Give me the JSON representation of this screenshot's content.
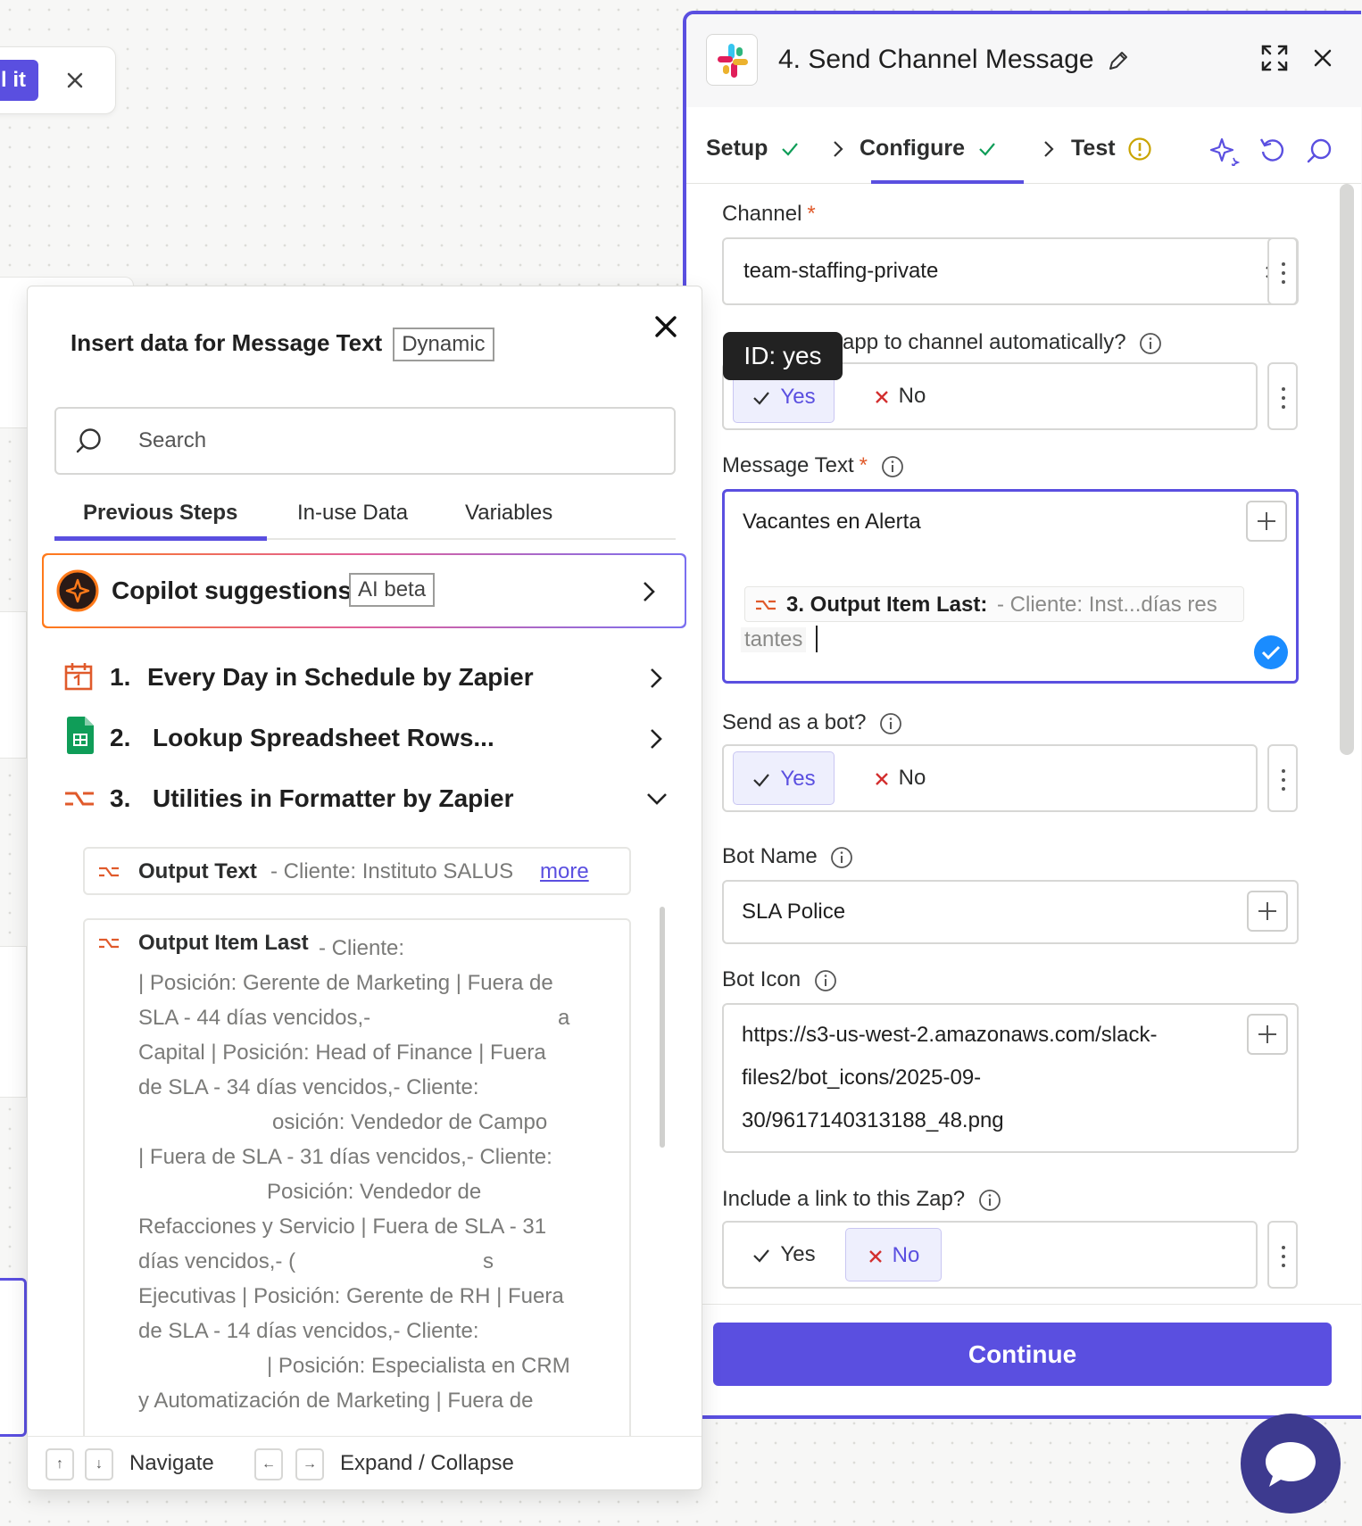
{
  "toast": {
    "button_label": "l it"
  },
  "panel": {
    "title": "4. Send Channel Message",
    "tabs": {
      "setup": "Setup",
      "configure": "Configure",
      "test": "Test"
    },
    "channel": {
      "label": "Channel",
      "value": "team-staffing-private"
    },
    "tooltip": "ID: yes",
    "add_app": {
      "label": "app to channel automatically?",
      "yes": "Yes",
      "no": "No",
      "selected": "Yes"
    },
    "message_text": {
      "label": "Message Text",
      "line1": "Vacantes en Alerta",
      "pill_label": "3. Output Item Last:",
      "pill_value": "- Cliente: Inst...días res",
      "line3": "tantes"
    },
    "send_as_bot": {
      "label": "Send as a bot?",
      "yes": "Yes",
      "no": "No",
      "selected": "Yes"
    },
    "bot_name": {
      "label": "Bot Name",
      "value": "SLA Police"
    },
    "bot_icon": {
      "label": "Bot Icon",
      "line1": "https://s3-us-west-2.amazonaws.com/slack-",
      "line2": "files2/bot_icons/2025-09-",
      "line3": "30/9617140313188_48.png"
    },
    "include_link": {
      "label": "Include a link to this Zap?",
      "yes": "Yes",
      "no": "No",
      "selected": "No"
    },
    "continue_label": "Continue"
  },
  "popover": {
    "title": "Insert data for Message Text",
    "badge": "Dynamic",
    "search_placeholder": "Search",
    "tabs": [
      "Previous Steps",
      "In-use Data",
      "Variables"
    ],
    "copilot": {
      "label": "Copilot suggestions",
      "badge": "AI beta"
    },
    "steps": [
      {
        "num": "1.",
        "label": "Every Day in Schedule by Zapier"
      },
      {
        "num": "2.",
        "label": "Lookup Spreadsheet Rows..."
      },
      {
        "num": "3.",
        "label": "Utilities in Formatter by Zapier"
      }
    ],
    "output_text": {
      "label": "Output Text",
      "value": "- Cliente: Instituto SALUS",
      "more": "more"
    },
    "output_item_last": {
      "label": "Output Item Last",
      "lines": [
        "- Cliente:",
        "| Posición: Gerente de Marketing | Fuera de",
        "SLA - 44 días vencidos,-",
        "a",
        "Capital | Posición: Head of Finance | Fuera",
        "de SLA - 34 días vencidos,- Cliente:",
        "osición: Vendedor de Campo",
        "| Fuera de SLA - 31 días vencidos,- Cliente:",
        "Posición: Vendedor de",
        "Refacciones y Servicio | Fuera de SLA - 31",
        "días vencidos,- (",
        "s",
        "Ejecutivas | Posición: Gerente de RH | Fuera",
        "de SLA - 14 días vencidos,- Cliente:",
        "| Posición: Especialista en CRM",
        "y Automatización de Marketing | Fuera de"
      ]
    },
    "footer": {
      "up": "↑",
      "down": "↓",
      "navigate": "Navigate",
      "left": "←",
      "right": "→",
      "expand": "Expand / Collapse"
    }
  },
  "colors": {
    "accent": "#5a4fe0",
    "orange": "#e05a2b",
    "green": "#0f9d58",
    "text": "#2d2e2e",
    "muted": "#8a8a88"
  }
}
